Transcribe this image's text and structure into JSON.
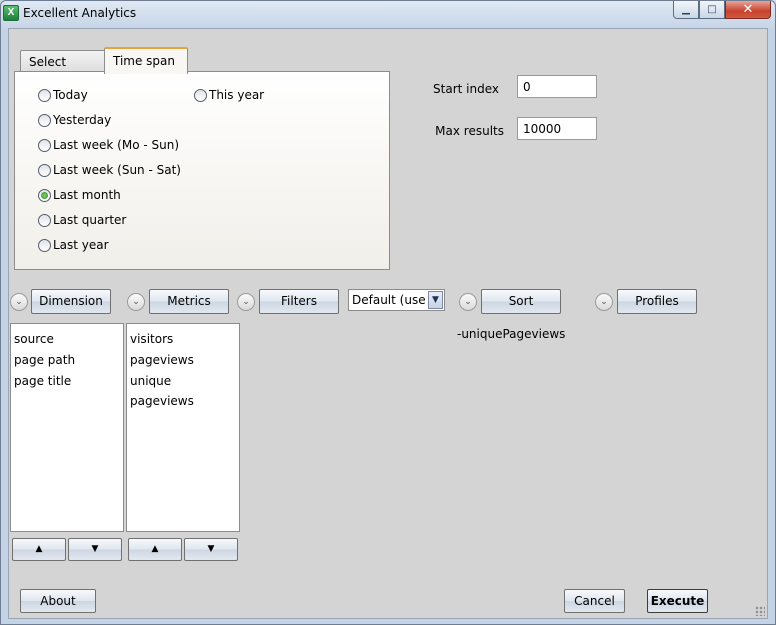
{
  "window": {
    "title": "Excellent Analytics",
    "app_icon_letter": "X",
    "minimize_glyph": "▁",
    "maximize_glyph": "□",
    "close_glyph": "✕"
  },
  "tabs": {
    "select_dates": "Select dates",
    "time_span": "Time span"
  },
  "time_span": {
    "options": [
      "Today",
      "Yesterday",
      "Last week (Mo - Sun)",
      "Last week (Sun - Sat)",
      "Last month",
      "Last quarter",
      "Last year",
      "This year"
    ],
    "selected": "Last month"
  },
  "fields": {
    "start_index_label": "Start index",
    "start_index_value": "0",
    "max_results_label": "Max results",
    "max_results_value": "10000"
  },
  "buttons": {
    "dimension": "Dimension",
    "metrics": "Metrics",
    "filters": "Filters",
    "sort": "Sort",
    "profiles": "Profiles",
    "about": "About",
    "cancel": "Cancel",
    "execute": "Execute",
    "up_glyph": "▲",
    "down_glyph": "▼",
    "expander_glyph": "⌄"
  },
  "filter_combo": {
    "value": "Default (use if",
    "arrow_glyph": "▼"
  },
  "dimensions": [
    "source",
    "page path",
    "page title"
  ],
  "metrics": [
    "visitors",
    "pageviews",
    "unique pageviews"
  ],
  "sort_value": "-uniquePageviews",
  "colors": {
    "tab_accent": "#e8a43a",
    "radio_checked": "#2b8a21",
    "close_button": "#c7412d"
  }
}
